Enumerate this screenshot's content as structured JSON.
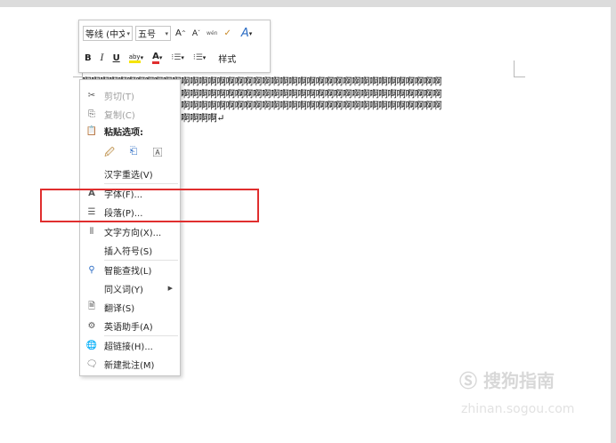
{
  "document": {
    "lines": [
      "啊啊啊啊啊啊啊啊啊啊啊啊啊啊啊啊啊啊啊啊啊啊啊啊啊啊啊啊啊啊啊啊啊啊啊啊啊啊啊啊",
      "啊啊啊啊啊啊啊啊啊啊啊啊啊啊啊啊啊啊啊啊啊啊啊啊啊啊啊啊啊啊啊啊啊啊啊啊啊啊啊啊",
      "啊啊啊啊啊啊啊啊啊啊啊啊啊啊啊啊啊啊啊啊啊啊啊啊啊啊啊啊啊啊啊啊啊啊啊啊啊啊啊啊",
      "啊啊啊啊啊啊啊啊啊啊啊啊啊啊啊↵"
    ]
  },
  "toolbar": {
    "font_name": "等线 (中文",
    "font_size": "五号",
    "grow": "A",
    "shrink": "A",
    "phonetic": "wén",
    "brush": "✓",
    "styles_icon": "A",
    "bold": "B",
    "italic": "I",
    "underline": "U",
    "highlight": "aby",
    "font_color": "A",
    "bullets": "⁝☰",
    "numbering": "⁝☰",
    "styles_label": "样式"
  },
  "context_menu": {
    "cut": "剪切(T)",
    "copy": "复制(C)",
    "paste_options": "粘贴选项:",
    "reconvert": "汉字重选(V)",
    "font": "字体(F)...",
    "paragraph": "段落(P)...",
    "text_direction": "文字方向(X)...",
    "insert_symbol": "插入符号(S)",
    "smart_lookup": "智能查找(L)",
    "synonyms": "同义词(Y)",
    "translate": "翻译(S)",
    "english_assistant": "英语助手(A)",
    "hyperlink": "超链接(H)...",
    "new_comment": "新建批注(M)"
  },
  "watermark": {
    "brand": "搜狗指南",
    "url": "zhinan.sogou.com"
  },
  "colors": {
    "highlight_box": "#e02e2e",
    "font_color_underline": "#e02e2e",
    "highlighter": "#f5e400"
  }
}
